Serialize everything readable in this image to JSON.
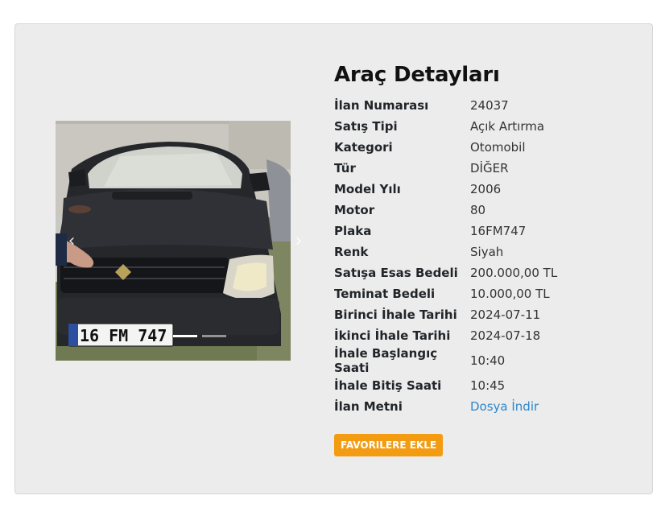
{
  "title": "Araç Detayları",
  "details": [
    {
      "label": "İlan Numarası",
      "value": "24037"
    },
    {
      "label": "Satış Tipi",
      "value": "Açık Artırma"
    },
    {
      "label": "Kategori",
      "value": "Otomobil"
    },
    {
      "label": "Tür",
      "value": "DİĞER"
    },
    {
      "label": "Model Yılı",
      "value": "2006"
    },
    {
      "label": "Motor",
      "value": "80"
    },
    {
      "label": "Plaka",
      "value": "16FM747"
    },
    {
      "label": "Renk",
      "value": "Siyah"
    },
    {
      "label": "Satışa Esas Bedeli",
      "value": "200.000,00 TL"
    },
    {
      "label": "Teminat Bedeli",
      "value": "10.000,00 TL"
    },
    {
      "label": "Birinci İhale Tarihi",
      "value": "2024-07-11"
    },
    {
      "label": "İkinci İhale Tarihi",
      "value": "2024-07-18"
    },
    {
      "label": "İhale Başlangıç Saati",
      "value": "10:40"
    },
    {
      "label": "İhale Bitiş Saati",
      "value": "10:45"
    },
    {
      "label": "İlan Metni",
      "value": "Dosya İndir",
      "link": true
    }
  ],
  "photo": {
    "plate_text": "16 FM 747",
    "slide_count": 2,
    "active_slide": 1
  },
  "buttons": {
    "favorite": "FAVORILERE EKLE"
  },
  "colors": {
    "card_bg": "#ececec",
    "button_bg": "#f39c12",
    "link": "#2f86c9"
  }
}
